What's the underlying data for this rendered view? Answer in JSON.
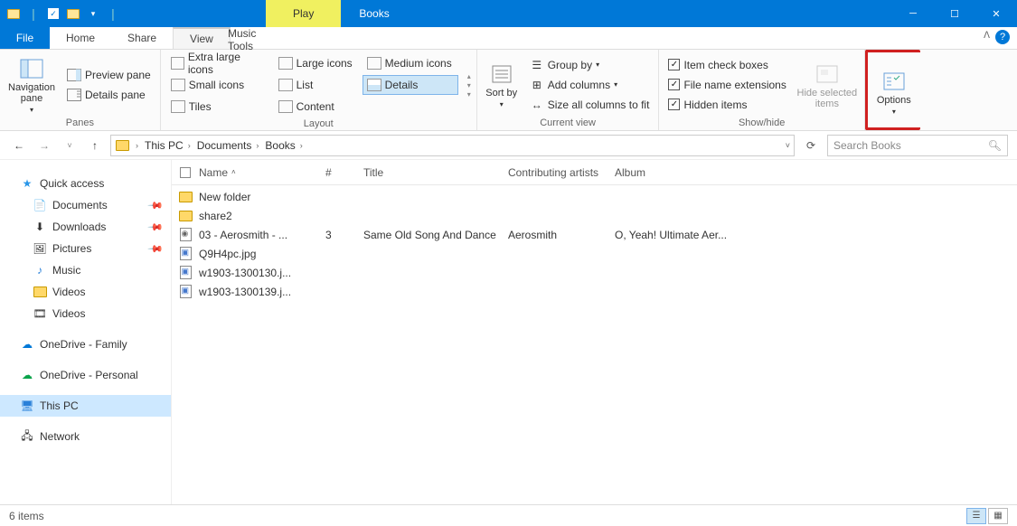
{
  "titlebar": {
    "context_tab": "Play",
    "window_title": "Books"
  },
  "tabs": {
    "file": "File",
    "home": "Home",
    "share": "Share",
    "view": "View",
    "music_tools": "Music Tools"
  },
  "ribbon": {
    "panes": {
      "navigation": "Navigation pane",
      "preview": "Preview pane",
      "details": "Details pane",
      "group_label": "Panes"
    },
    "layout": {
      "extra_large": "Extra large icons",
      "large": "Large icons",
      "medium": "Medium icons",
      "small": "Small icons",
      "list": "List",
      "details": "Details",
      "tiles": "Tiles",
      "content": "Content",
      "group_label": "Layout"
    },
    "current_view": {
      "sort": "Sort by",
      "group": "Group by",
      "add_columns": "Add columns",
      "size_all": "Size all columns to fit",
      "group_label": "Current view"
    },
    "show_hide": {
      "item_check": "Item check boxes",
      "file_ext": "File name extensions",
      "hidden": "Hidden items",
      "hide_selected": "Hide selected items",
      "group_label": "Show/hide"
    },
    "options": "Options"
  },
  "breadcrumb": {
    "items": [
      "This PC",
      "Documents",
      "Books"
    ]
  },
  "search": {
    "placeholder": "Search Books"
  },
  "sidebar": {
    "quick_access": "Quick access",
    "documents": "Documents",
    "downloads": "Downloads",
    "pictures": "Pictures",
    "music": "Music",
    "videos1": "Videos",
    "videos2": "Videos",
    "onedrive_family": "OneDrive - Family",
    "onedrive_personal": "OneDrive - Personal",
    "this_pc": "This PC",
    "network": "Network"
  },
  "columns": {
    "name": "Name",
    "num": "#",
    "title": "Title",
    "artist": "Contributing artists",
    "album": "Album"
  },
  "files": [
    {
      "type": "folder",
      "name": "New folder",
      "num": "",
      "title": "",
      "artist": "",
      "album": ""
    },
    {
      "type": "folder",
      "name": "share2",
      "num": "",
      "title": "",
      "artist": "",
      "album": ""
    },
    {
      "type": "audio",
      "name": "03 - Aerosmith - ...",
      "num": "3",
      "title": "Same Old Song And Dance",
      "artist": "Aerosmith",
      "album": "O, Yeah! Ultimate Aer..."
    },
    {
      "type": "image",
      "name": "Q9H4pc.jpg",
      "num": "",
      "title": "",
      "artist": "",
      "album": ""
    },
    {
      "type": "image",
      "name": "w1903-1300130.j...",
      "num": "",
      "title": "",
      "artist": "",
      "album": ""
    },
    {
      "type": "image",
      "name": "w1903-1300139.j...",
      "num": "",
      "title": "",
      "artist": "",
      "album": ""
    }
  ],
  "status": {
    "item_count": "6 items"
  }
}
